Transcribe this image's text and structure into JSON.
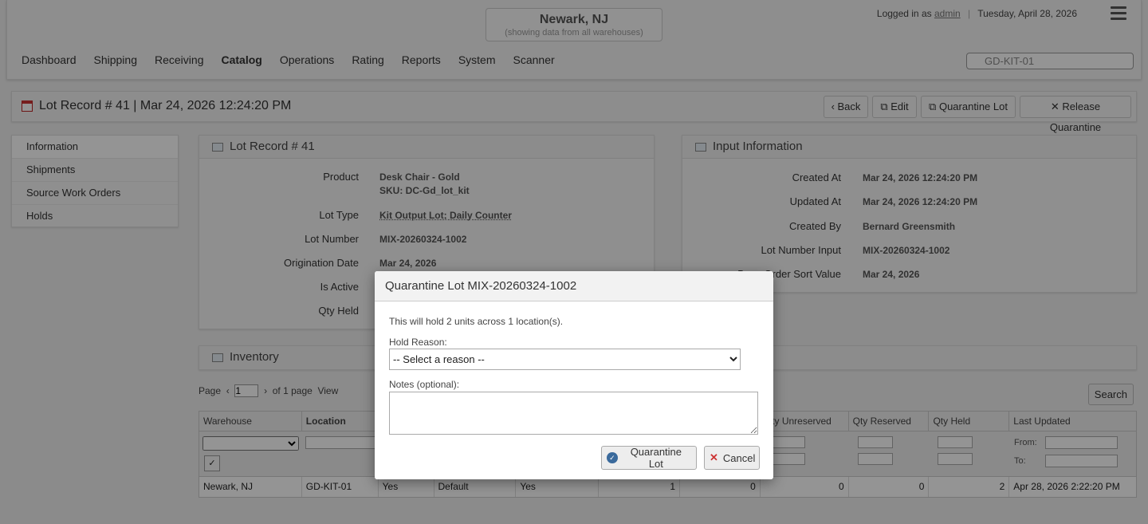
{
  "header": {
    "warehouse_name": "Newark, NJ",
    "warehouse_sub": "(showing data from all warehouses)",
    "logged_in_prefix": "Logged in as",
    "user": "admin",
    "date": "Tuesday, April 28, 2026",
    "search_value": "GD-KIT-01"
  },
  "nav": [
    "Dashboard",
    "Shipping",
    "Receiving",
    "Catalog",
    "Operations",
    "Rating",
    "Reports",
    "System",
    "Scanner"
  ],
  "titlebar": {
    "title": "Lot Record # 41 | Mar 24, 2026 12:24:20 PM",
    "back": "Back",
    "edit": "Edit",
    "quarantine": "Quarantine Lot",
    "release": "Release Quarantine"
  },
  "sidebar": [
    "Information",
    "Shipments",
    "Source Work Orders",
    "Holds"
  ],
  "lot_panel": {
    "title": "Lot Record # 41",
    "product_label": "Product",
    "product_name": "Desk Chair - Gold",
    "product_sku": "SKU:  DC-Gd_lot_kit",
    "lot_type_label": "Lot Type",
    "lot_type": "Kit Output Lot; Daily Counter",
    "lot_number_label": "Lot Number",
    "lot_number": "MIX-20260324-1002",
    "origination_label": "Origination Date",
    "origination": "Mar 24, 2026",
    "is_active_label": "Is Active",
    "qty_held_label": "Qty Held"
  },
  "input_panel": {
    "title": "Input Information",
    "created_at_label": "Created At",
    "created_at": "Mar 24, 2026 12:24:20 PM",
    "updated_at_label": "Updated At",
    "updated_at": "Mar 24, 2026 12:24:20 PM",
    "created_by_label": "Created By",
    "created_by": "Bernard Greensmith",
    "lot_input_label": "Lot Number Input",
    "lot_input": "MIX-20260324-1002",
    "sort_label": "Base Order Sort Value",
    "sort_value": "Mar 24, 2026"
  },
  "inventory": {
    "title": "Inventory",
    "page_label": "Page",
    "page_value": "1",
    "of_pages": "of 1 page",
    "view_label": "View",
    "search_button": "Search",
    "columns": [
      "Warehouse",
      "Location",
      "",
      "",
      "",
      "",
      "Qty Unreserved",
      "Qty Reserved",
      "Qty Held",
      "Last Updated"
    ],
    "from_label": "From:",
    "to_label": "To:",
    "row": [
      "Newark, NJ",
      "GD-KIT-01",
      "Yes",
      "Default",
      "Yes",
      "1",
      "0",
      "0",
      "0",
      "2",
      "Apr 28, 2026 2:22:20 PM"
    ]
  },
  "modal": {
    "title": "Quarantine Lot MIX-20260324-1002",
    "message": "This will hold 2 units across 1 location(s).",
    "reason_label": "Hold Reason:",
    "reason_selected": "-- Select a reason --",
    "notes_label": "Notes (optional):",
    "quarantine_button": "Quarantine Lot",
    "cancel_button": "Cancel"
  }
}
